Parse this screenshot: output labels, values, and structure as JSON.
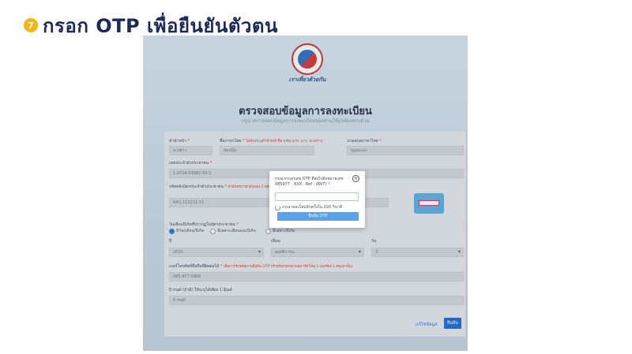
{
  "step": {
    "number": "7",
    "title": "กรอก OTP เพื่อยืนยันตัวตน"
  },
  "site": {
    "brand": "เราเที่ยวด้วยกัน",
    "page_title": "ตรวจสอบข้อมูลการลงทะเบียน",
    "page_subtitle": "กรุณาตรวจสอบข้อมูลการลงทะเบียนของท่านให้ถูกต้องครบถ้วน"
  },
  "form": {
    "prefix_label": "คำนำหน้า",
    "prefix_value": "นางสาว",
    "firstname_label": "ชื่อภาษาไทย",
    "firstname_note": "ไม่ต้องระบุคำนำหน้าชื่อ (เช่น นาย, นาง, นางสาว)",
    "firstname_value": "สมหญิง",
    "lastname_label": "นามสกุลภาษาไทย",
    "lastname_value": "บุญนะเอง",
    "idcard_label": "เลขประจำตัวประชาชน",
    "idcard_value": "1-1014-01681-03-1",
    "laser_label": "รหัสหลังบัตรประจำตัวประชาชน",
    "laser_note": "ตัวอักษรภาษาอังกฤษ 2 หลัก และตัวเลข",
    "laser_value": "AA1-111111-11",
    "birth_label": "วันเดือนปีเกิดที่ปรากฏในบัตรประชาชน",
    "birth_options": [
      "มีวัน/เดือน/ปีเกิด",
      "มีเฉพาะเดือนและปีเกิด",
      "มีเฉพาะปีเกิด"
    ],
    "day_label": "ปี",
    "day_value": "2532",
    "month_label": "เดือน",
    "month_value": "พฤศจิกายน",
    "year_label": "วัน",
    "year_value": "3",
    "phone_label": "เบอร์โทรศัพท์มือถือที่ติดต่อได้",
    "phone_note": "เพื่อการรับรหัสผ่านยืนยัน OTP (สำหรับกรอกผ่านสมาร์ทโฟน 1 เบอร์ต่อ 1 คนเท่านั้น)",
    "phone_value": "085-977-5900",
    "email_label": "E-mail (ถ้ามี) ให้ระบุได้เพียง 1 อีเมล์",
    "email_placeholder": "E-mail",
    "edit_button": "แก้ไขข้อมูล",
    "confirm_button": "ยืนยัน"
  },
  "modal": {
    "message": "กรุณากรอกเลข OTP ที่ส่งไปยังหมายเลข 085977 · XXX · Ref : (RVT)",
    "required_mark": "*",
    "resend_text": "กรุณาลองใหม่อีกครั้งใน 293 วินาที",
    "submit_label": "ยืนยัน OTP"
  }
}
